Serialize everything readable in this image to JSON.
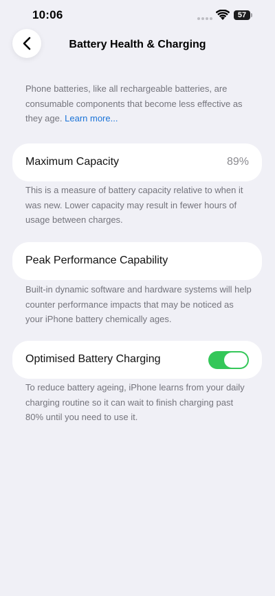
{
  "status_bar": {
    "time": "10:06",
    "battery_level": "57",
    "icons": [
      "signal-dots-icon",
      "wifi-icon",
      "battery-icon"
    ]
  },
  "nav": {
    "back_icon": "chevron-left-icon",
    "title": "Battery Health & Charging"
  },
  "intro": {
    "text": "Phone batteries, like all rechargeable batteries, are consumable components that become less effective as they age.",
    "link": "Learn more..."
  },
  "maximum_capacity": {
    "label": "Maximum Capacity",
    "value": "89%",
    "description": "This is a measure of battery capacity relative to when it was new. Lower capacity may result in fewer hours of usage between charges."
  },
  "peak_performance": {
    "label": "Peak Performance Capability",
    "description": "Built-in dynamic software and hardware systems will help counter performance impacts that may be noticed as your iPhone battery chemically ages."
  },
  "optimised_charging": {
    "label": "Optimised Battery Charging",
    "enabled": true,
    "description": "To reduce battery ageing, iPhone learns from your daily charging routine so it can wait to finish charging past 80% until you need to use it."
  },
  "colors": {
    "background": "#f0f0f6",
    "card": "#ffffff",
    "toggle_on": "#34c759",
    "link": "#1a73d8",
    "secondary_text": "#74747c"
  }
}
